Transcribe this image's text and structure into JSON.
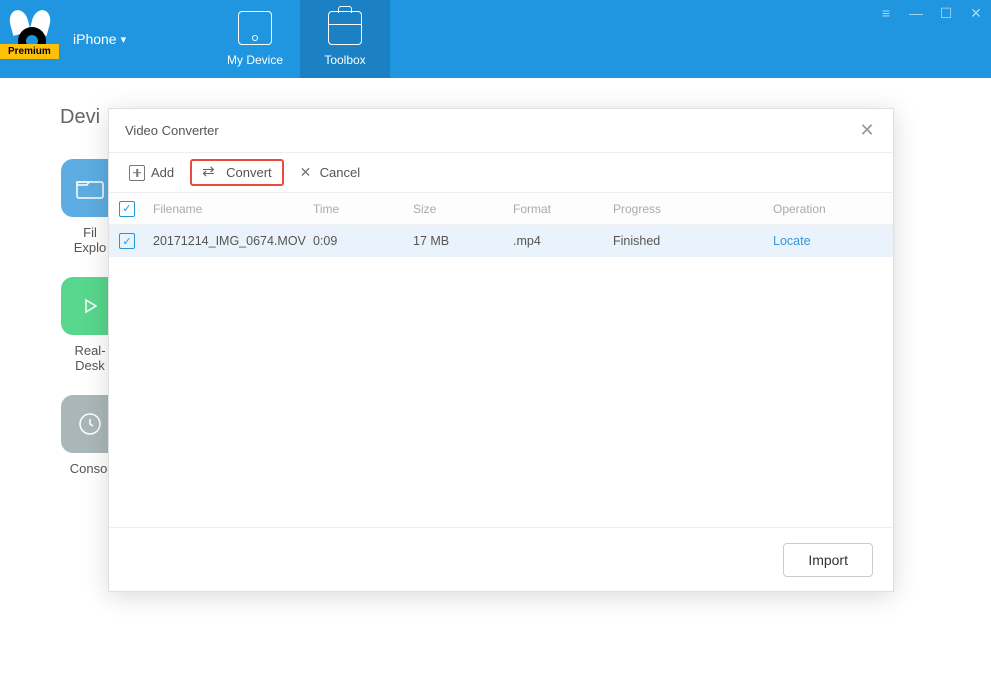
{
  "header": {
    "device_selector": "iPhone",
    "premium_label": "Premium",
    "tabs": [
      {
        "label": "My Device"
      },
      {
        "label": "Toolbox"
      }
    ]
  },
  "bg": {
    "page_title_partial": "Devi",
    "tools": [
      {
        "label": "File Explorer",
        "partial": "Fil\nExplo"
      },
      {
        "label": "Real-time Desktop",
        "partial": "Real-\nDesk"
      },
      {
        "label": "Console",
        "partial": "Consol"
      }
    ]
  },
  "modal": {
    "title": "Video Converter",
    "toolbar": {
      "add": "Add",
      "convert": "Convert",
      "cancel": "Cancel"
    },
    "columns": {
      "filename": "Filename",
      "time": "Time",
      "size": "Size",
      "format": "Format",
      "progress": "Progress",
      "operation": "Operation"
    },
    "rows": [
      {
        "filename": "20171214_IMG_0674.MOV",
        "time": "0:09",
        "size": "17 MB",
        "format": ".mp4",
        "progress": "Finished",
        "operation": "Locate"
      }
    ],
    "footer": {
      "import": "Import"
    }
  }
}
